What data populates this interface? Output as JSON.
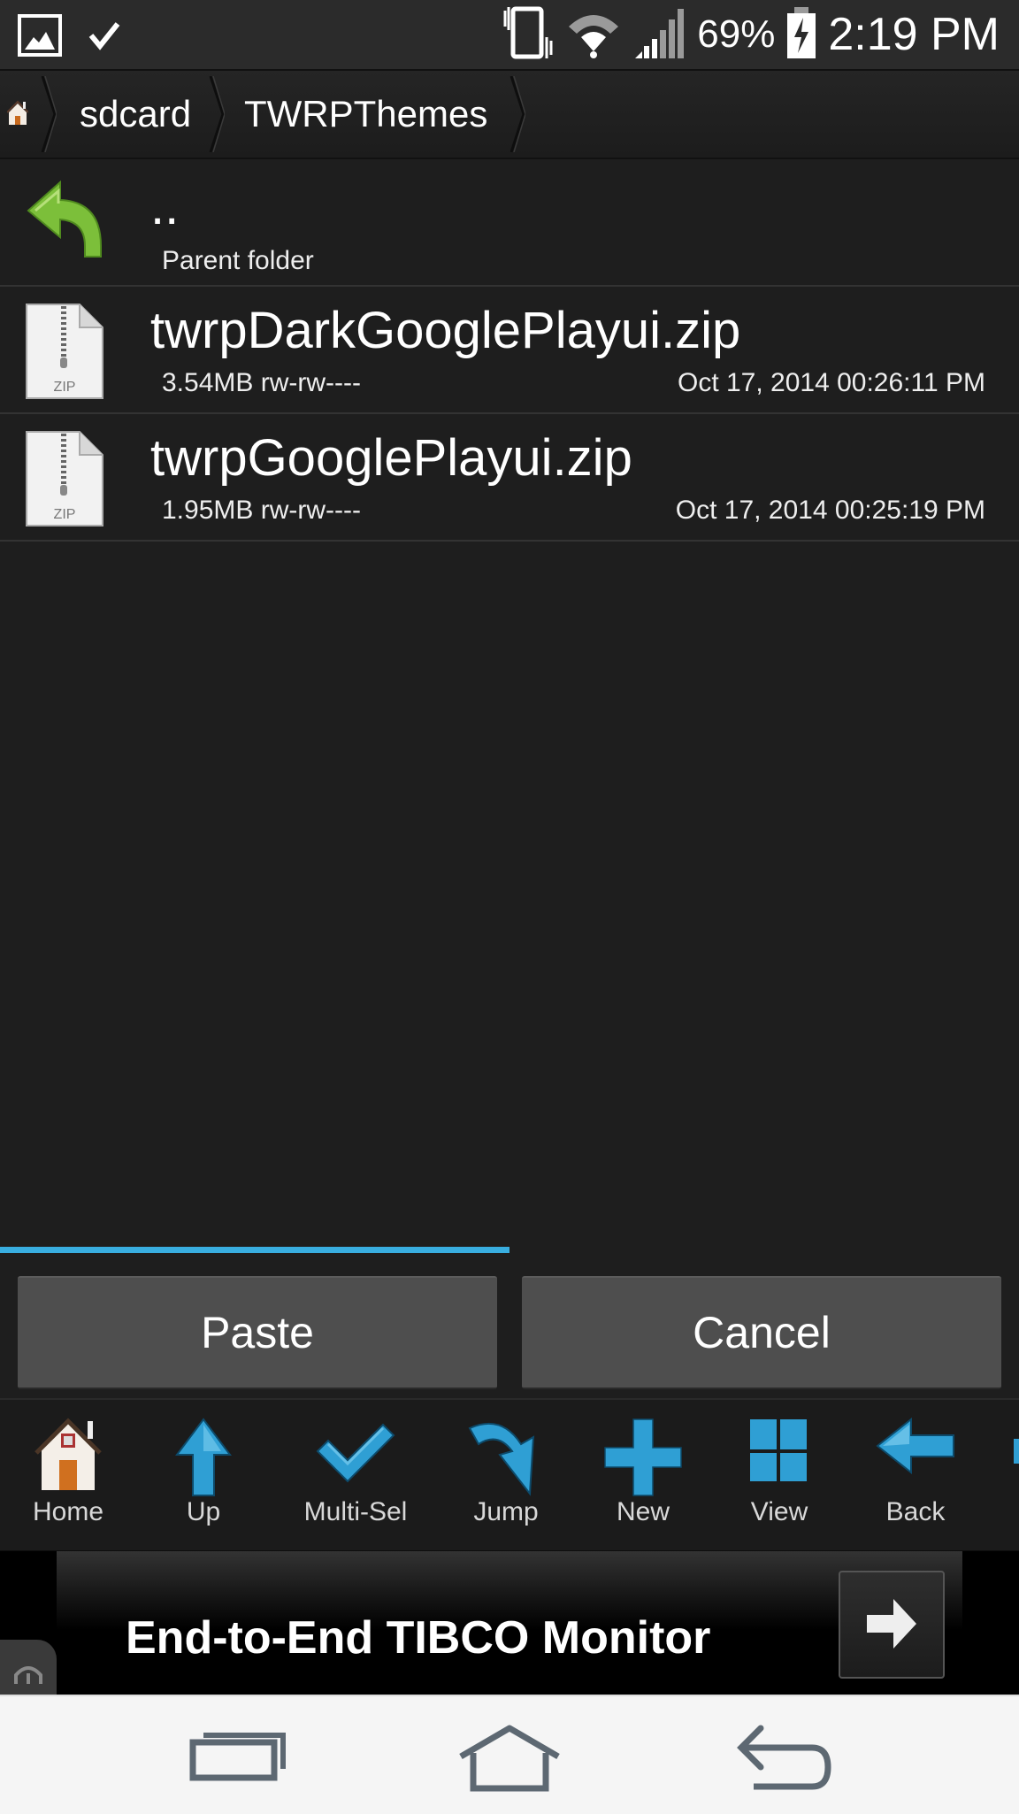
{
  "status_bar": {
    "notifications": [
      "image-icon",
      "check-icon"
    ],
    "indicators": [
      "vibrate-icon",
      "wifi-icon",
      "signal-icon"
    ],
    "battery_percent": "69%",
    "battery_charging": true,
    "time": "2:19 PM"
  },
  "breadcrumb": {
    "home_icon": "home-icon",
    "items": [
      "sdcard",
      "TWRPThemes"
    ]
  },
  "file_list": {
    "parent": {
      "name": "..",
      "subtitle": "Parent folder"
    },
    "files": [
      {
        "name": "twrpDarkGooglePlayui.zip",
        "size": "3.54MB",
        "perms": "rw-rw----",
        "meta": "3.54MB rw-rw----",
        "date": "Oct 17, 2014 00:26:11 PM",
        "icon": "zip-file-icon"
      },
      {
        "name": "twrpGooglePlayui.zip",
        "size": "1.95MB",
        "perms": "rw-rw----",
        "meta": "1.95MB rw-rw----",
        "date": "Oct 17, 2014 00:25:19 PM",
        "icon": "zip-file-icon"
      }
    ]
  },
  "progress": {
    "percent": 50,
    "color": "#39aee0"
  },
  "actions": {
    "paste_label": "Paste",
    "cancel_label": "Cancel"
  },
  "toolbar": {
    "items": [
      {
        "label": "Home",
        "icon": "home-icon"
      },
      {
        "label": "Up",
        "icon": "up-arrow-icon"
      },
      {
        "label": "Multi-Sel",
        "icon": "checkmark-icon"
      },
      {
        "label": "Jump",
        "icon": "jump-arrow-icon"
      },
      {
        "label": "New",
        "icon": "plus-icon"
      },
      {
        "label": "View",
        "icon": "grid-view-icon"
      },
      {
        "label": "Back",
        "icon": "back-arrow-icon"
      }
    ],
    "accent": "#2f9fd4"
  },
  "ad": {
    "text": "End-to-End TIBCO Monitor"
  },
  "nav_bar": {
    "buttons": [
      "recent-apps",
      "home",
      "back"
    ]
  }
}
